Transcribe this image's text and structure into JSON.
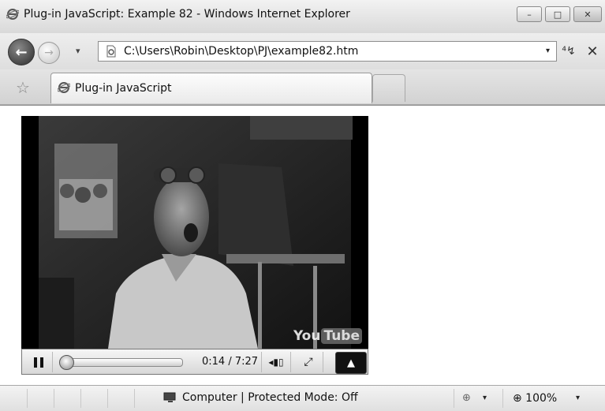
{
  "window": {
    "title": "Plug-in JavaScript: Example 82 - Windows Internet Explorer",
    "controls": {
      "minimize": "–",
      "maximize": "□",
      "close": "✕"
    }
  },
  "nav": {
    "back_glyph": "←",
    "forward_glyph": "→",
    "dropdown_glyph": "▾",
    "address": "C:\\Users\\Robin\\Desktop\\PJ\\example82.htm",
    "address_drop": "▾",
    "refresh_glyph": "⁴↯",
    "stop_glyph": "✕"
  },
  "tabs": {
    "favorites_glyph": "☆",
    "active_tab_title": "Plug-in JavaScript"
  },
  "player": {
    "logo_you": "You",
    "logo_tube": "Tube",
    "time": "0:14 / 7:27",
    "progress_fraction": 0.031,
    "volume_glyph": "◂▮▯",
    "fullscreen_glyph": "⤢",
    "menu_glyph": "▲"
  },
  "status": {
    "zone_text": "Computer | Protected Mode: Off",
    "lock_glyph": "⊕",
    "zoom": "⊕ 100%",
    "drop": "▾"
  },
  "colors": {
    "chrome_light": "#f2f2f2",
    "chrome_dark": "#d9d9d9",
    "player_bg": "#000000"
  }
}
